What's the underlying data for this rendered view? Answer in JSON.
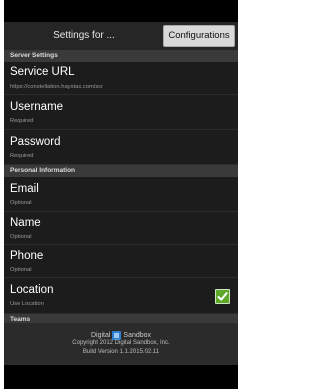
{
  "header": {
    "title": "Settings for ...",
    "configurations_button": "Configurations"
  },
  "sections": {
    "server": "Server Settings",
    "personal": "Personal Information",
    "teams": "Teams"
  },
  "server_rows": [
    {
      "title": "Service URL",
      "subtitle": "https://constellation.haystax.com/scr"
    },
    {
      "title": "Username",
      "subtitle": "Required"
    },
    {
      "title": "Password",
      "subtitle": "Required"
    }
  ],
  "personal_rows": [
    {
      "title": "Email",
      "subtitle": "Optional"
    },
    {
      "title": "Name",
      "subtitle": "Optional"
    },
    {
      "title": "Phone",
      "subtitle": "Optional"
    },
    {
      "title": "Location",
      "subtitle": "Use Location",
      "checked": true
    }
  ],
  "footer": {
    "logo_left": "Digital",
    "logo_right": "Sandbox",
    "copyright": "Copyright 2012 Digital Sandbox, Inc.",
    "build": "Build Version 1.1.2015.02.11"
  },
  "icons": {
    "checkbox": "check-icon",
    "logo": "digital-sandbox-logo-icon"
  },
  "colors": {
    "checkbox_green": "#5fa92a",
    "section_header_bg": "#3a3a3a",
    "content_bg": "#1c1c1c"
  }
}
